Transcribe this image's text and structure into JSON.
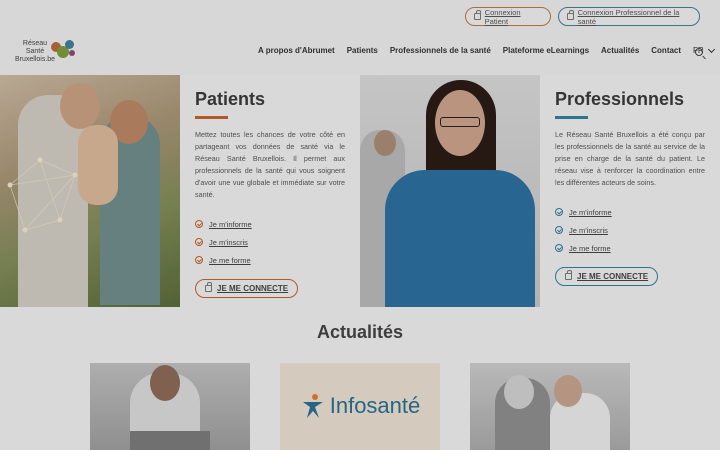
{
  "header": {
    "logo_lines": [
      "Réseau",
      "Santé",
      "Bruxellois.be"
    ],
    "login_patient": "Connexion Patient",
    "login_pro": "Connexion Professionnel de la santé",
    "nav": [
      "A propos d'Abrumet",
      "Patients",
      "Professionnels de la santé",
      "Plateforme eLearnings",
      "Actualités",
      "Contact"
    ],
    "lang": "FR"
  },
  "patients": {
    "title": "Patients",
    "accent": "#c0612a",
    "text": "Mettez toutes les chances de votre côté en partageant vos données de santé via le Réseau Santé Bruxellois. Il permet aux professionnels de la santé qui vous soignent d'avoir une vue globale et immédiate sur votre santé.",
    "links": [
      "Je m'informe",
      "Je m'inscris",
      "Je me forme"
    ],
    "button": "JE ME CONNECTE"
  },
  "pros": {
    "title": "Professionnels",
    "accent": "#2f7f9a",
    "text": "Le Réseau Santé Bruxellois a été conçu par les professionnels de la santé au service de la prise en charge de la santé du patient. Le réseau vise à renforcer la coordination entre les différentes acteurs de soins.",
    "links": [
      "Je m'informe",
      "Je m'inscris",
      "Je me forme"
    ],
    "button": "JE ME CONNECTE"
  },
  "news": {
    "title": "Actualités",
    "card2_logo": "Infosanté"
  }
}
